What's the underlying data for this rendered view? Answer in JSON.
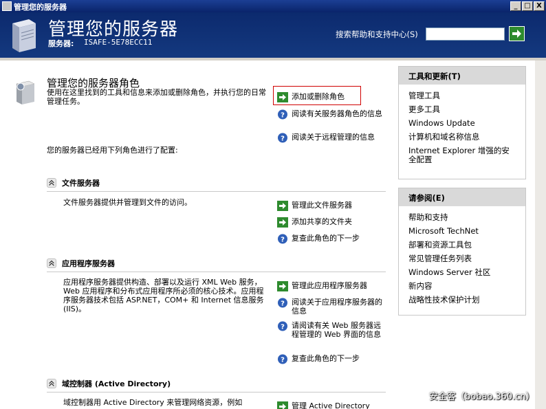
{
  "window": {
    "title": "管理您的服务器",
    "minimize_label": "_",
    "maximize_label": "□",
    "close_label": "X"
  },
  "header": {
    "title": "管理您的服务器",
    "server_label": "服务器:",
    "server_name": "ISAFE-5E78ECC11",
    "search_label": "搜索帮助和支持中心(S)",
    "search_value": ""
  },
  "main": {
    "title": "管理您的服务器角色",
    "description": "使用在这里找到的工具和信息来添加或删除角色，并执行您的日常管理任务。",
    "links": {
      "add_remove": "添加或删除角色",
      "read_roles": "阅读有关服务器角色的信息",
      "read_remote": "阅读关于远程管理的信息"
    },
    "configured_text": "您的服务器已经用下列角色进行了配置:"
  },
  "sections": {
    "file": {
      "title": "文件服务器",
      "description": "文件服务器提供并管理到文件的访问。",
      "links": [
        "管理此文件服务器",
        "添加共享的文件夹",
        "复查此角色的下一步"
      ]
    },
    "app": {
      "title": "应用程序服务器",
      "description": "应用程序服务器提供构造、部署以及运行 XML Web 服务，Web 应用程序和分布式应用程序所必须的核心技术。应用程序服务器技术包括 ASP.NET，COM+ 和 Internet 信息服务 (IIS)。",
      "links": [
        "管理此应用程序服务器",
        "阅读关于应用程序服务器的信息",
        "请阅读有关 Web 服务器远程管理的 Web 界面的信息",
        "复查此角色的下一步"
      ]
    },
    "dc": {
      "title": "域控制器 (Active Directory)",
      "description": "域控制器用 Active Directory 来管理网络资源，例如",
      "links": [
        "管理 Active Directory"
      ]
    }
  },
  "panels": {
    "tools": {
      "title": "工具和更新(T)",
      "items": [
        "管理工具",
        "更多工具",
        "Windows Update",
        "计算机和域名称信息",
        "Internet Explorer 增强的安全配置"
      ]
    },
    "see_also": {
      "title": "请参阅(E)",
      "items": [
        "帮助和支持",
        "Microsoft TechNet",
        "部署和资源工具包",
        "常见管理任务列表",
        "Windows Server 社区",
        "新内容",
        "战略性技术保护计划"
      ]
    }
  },
  "watermark": "安全客（bobao.360.cn）"
}
